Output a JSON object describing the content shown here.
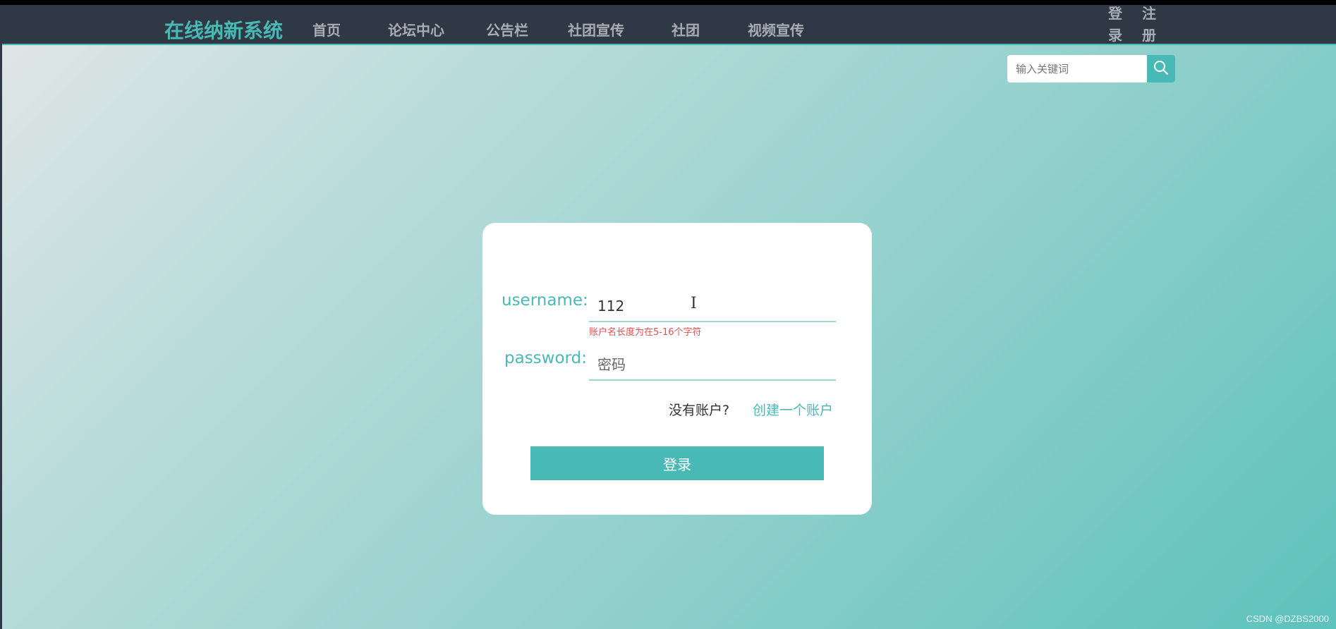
{
  "header": {
    "brand": "在线纳新系统",
    "nav_items": [
      "首页",
      "论坛中心",
      "公告栏",
      "社团宣传",
      "社团",
      "视频宣传"
    ],
    "login_label": "登录",
    "register_label": "注册"
  },
  "search": {
    "placeholder": "输入关键词",
    "icon": "search-icon"
  },
  "login_form": {
    "username_label": "username:",
    "username_value": "112",
    "username_error": "账户名长度为在5-16个字符",
    "password_label": "password:",
    "password_placeholder": "密码",
    "no_account_text": "没有账户?",
    "create_account_link": "创建一个账户",
    "submit_label": "登录"
  },
  "watermark": "CSDN @DZBS2000",
  "colors": {
    "accent": "#49b9b5",
    "navbar": "#2f3845",
    "error": "#e05252"
  }
}
